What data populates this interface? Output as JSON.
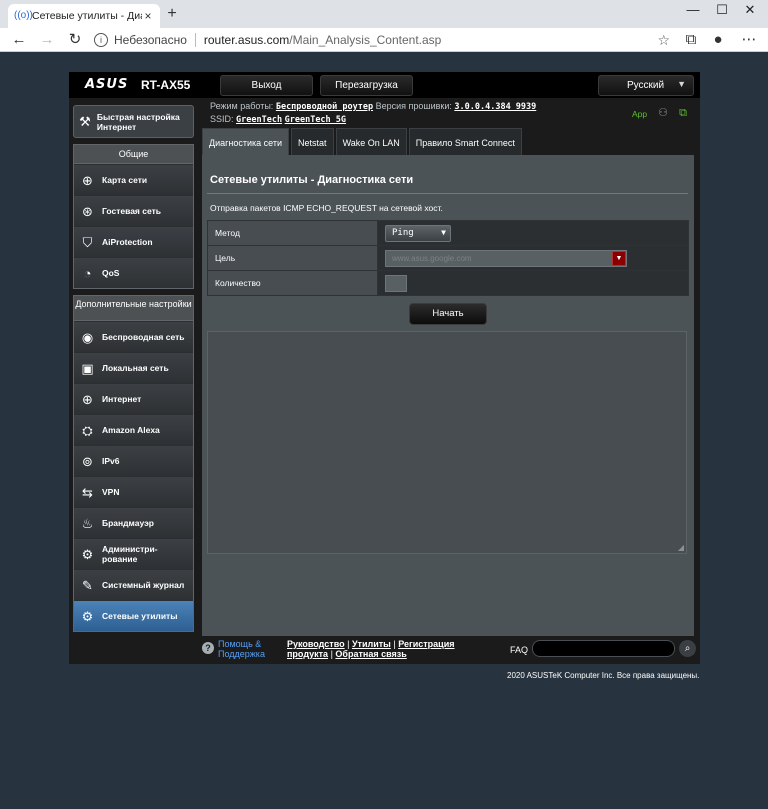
{
  "browser": {
    "tab_title": "Сетевые утилиты - Диагностика",
    "tab_close": "×",
    "new_tab": "+",
    "minimize": "—",
    "maximize": "☐",
    "close": "✕",
    "address_insecure": "Небезопасно",
    "url_host": "router.asus.com",
    "url_path": "/Main_Analysis_Content.asp"
  },
  "header": {
    "logo": "ASUS",
    "model": "RT-AX55",
    "logout": "Выход",
    "reboot": "Перезагрузка",
    "language": "Русский"
  },
  "status": {
    "mode_label": "Режим работы:",
    "mode_value": "Беспроводной роутер",
    "firmware_label": "Версия прошивки:",
    "firmware_value": "3.0.0.4.384_9939",
    "ssid_label": "SSID:",
    "ssid_1": "GreenTech",
    "ssid_2": "GreenTech_5G",
    "app": "App"
  },
  "sidebar": {
    "quick_setup": "Быстрая настройка Интернет",
    "general_title": "Общие",
    "general": [
      {
        "label": "Карта сети",
        "icon": "network-map-icon"
      },
      {
        "label": "Гостевая сеть",
        "icon": "guest-network-icon"
      },
      {
        "label": "AiProtection",
        "icon": "aiprotection-icon"
      },
      {
        "label": "QoS",
        "icon": "qos-icon"
      }
    ],
    "advanced_title": "Дополнительные настройки",
    "advanced": [
      {
        "label": "Беспроводная сеть",
        "icon": "wireless-icon"
      },
      {
        "label": "Локальная сеть",
        "icon": "lan-icon"
      },
      {
        "label": "Интернет",
        "icon": "wan-icon"
      },
      {
        "label": "Amazon Alexa",
        "icon": "alexa-icon"
      },
      {
        "label": "IPv6",
        "icon": "ipv6-icon"
      },
      {
        "label": "VPN",
        "icon": "vpn-icon"
      },
      {
        "label": "Брандмауэр",
        "icon": "firewall-icon"
      },
      {
        "label": "Администри-рование",
        "icon": "administration-icon"
      },
      {
        "label": "Системный журнал",
        "icon": "system-log-icon"
      },
      {
        "label": "Сетевые утилиты",
        "icon": "network-tools-icon"
      }
    ]
  },
  "tabs": [
    "Диагностика сети",
    "Netstat",
    "Wake On LAN",
    "Правило Smart Connect"
  ],
  "panel": {
    "title": "Сетевые утилиты - Диагностика сети",
    "description": "Отправка пакетов ICMP ECHO_REQUEST на сетевой хост.",
    "method_label": "Метод",
    "method_value": "Ping",
    "target_label": "Цель",
    "target_placeholder": "www.asus.google.com",
    "count_label": "Количество",
    "count_value": "",
    "start_button": "Начать"
  },
  "footer": {
    "help": "Помощь & Поддержка",
    "manual": "Руководство",
    "utilities": "Утилиты",
    "registration": "Регистрация продукта",
    "feedback": "Обратная связь",
    "faq": "FAQ",
    "copyright": "2020 ASUSTeK Computer Inc. Все права защищены."
  }
}
